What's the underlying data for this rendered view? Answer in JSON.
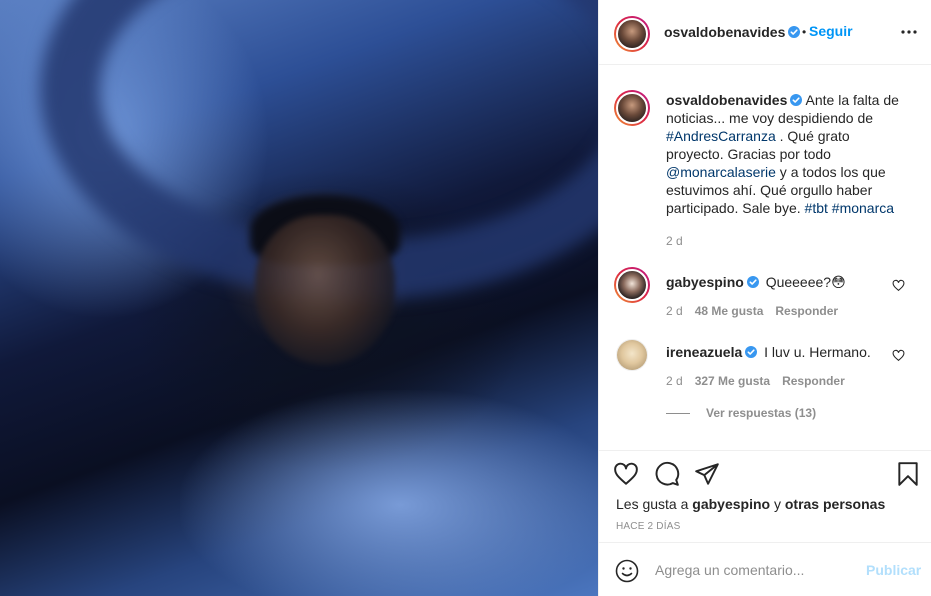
{
  "post": {
    "author": "osvaldobenavides",
    "follow_label": "Seguir",
    "follow_dot": "•",
    "caption": {
      "text_1": "Ante la falta de noticias... me voy despidiendo de ",
      "hashtag_1": "#AndresCarranza",
      "text_2": " . Qué grato proyecto. Gracias por todo ",
      "mention_1": "@monarcalaserie",
      "text_3": " y a todos los que estuvimos ahí. Qué orgullo haber participado. Sale bye. ",
      "hashtag_2": "#tbt",
      "hashtag_3": "#monarca",
      "time": "2 d"
    },
    "comments": [
      {
        "user": "gabyespino",
        "text": "Queeeee?😳",
        "time": "2 d",
        "likes": "48 Me gusta",
        "reply": "Responder"
      },
      {
        "user": "ireneazuela",
        "text": "I luv u. Hermano.",
        "time": "2 d",
        "likes": "327 Me gusta",
        "reply": "Responder"
      }
    ],
    "view_replies": "Ver respuestas (13)",
    "likes_text_prefix": "Les gusta a ",
    "likes_user": "gabyespino",
    "likes_text_mid": " y ",
    "likes_others": "otras personas",
    "timestamp": "HACE 2 DÍAS",
    "comment_placeholder": "Agrega un comentario...",
    "publish_label": "Publicar"
  },
  "colors": {
    "accent": "#0095f6",
    "link": "#00376b",
    "muted": "#8e8e8e",
    "verified": "#3897f0",
    "publish_disabled": "#b2dffc"
  },
  "icons": [
    "verified-icon",
    "more-options-icon",
    "heart-icon",
    "comment-icon",
    "share-icon",
    "bookmark-icon",
    "emoji-icon"
  ]
}
